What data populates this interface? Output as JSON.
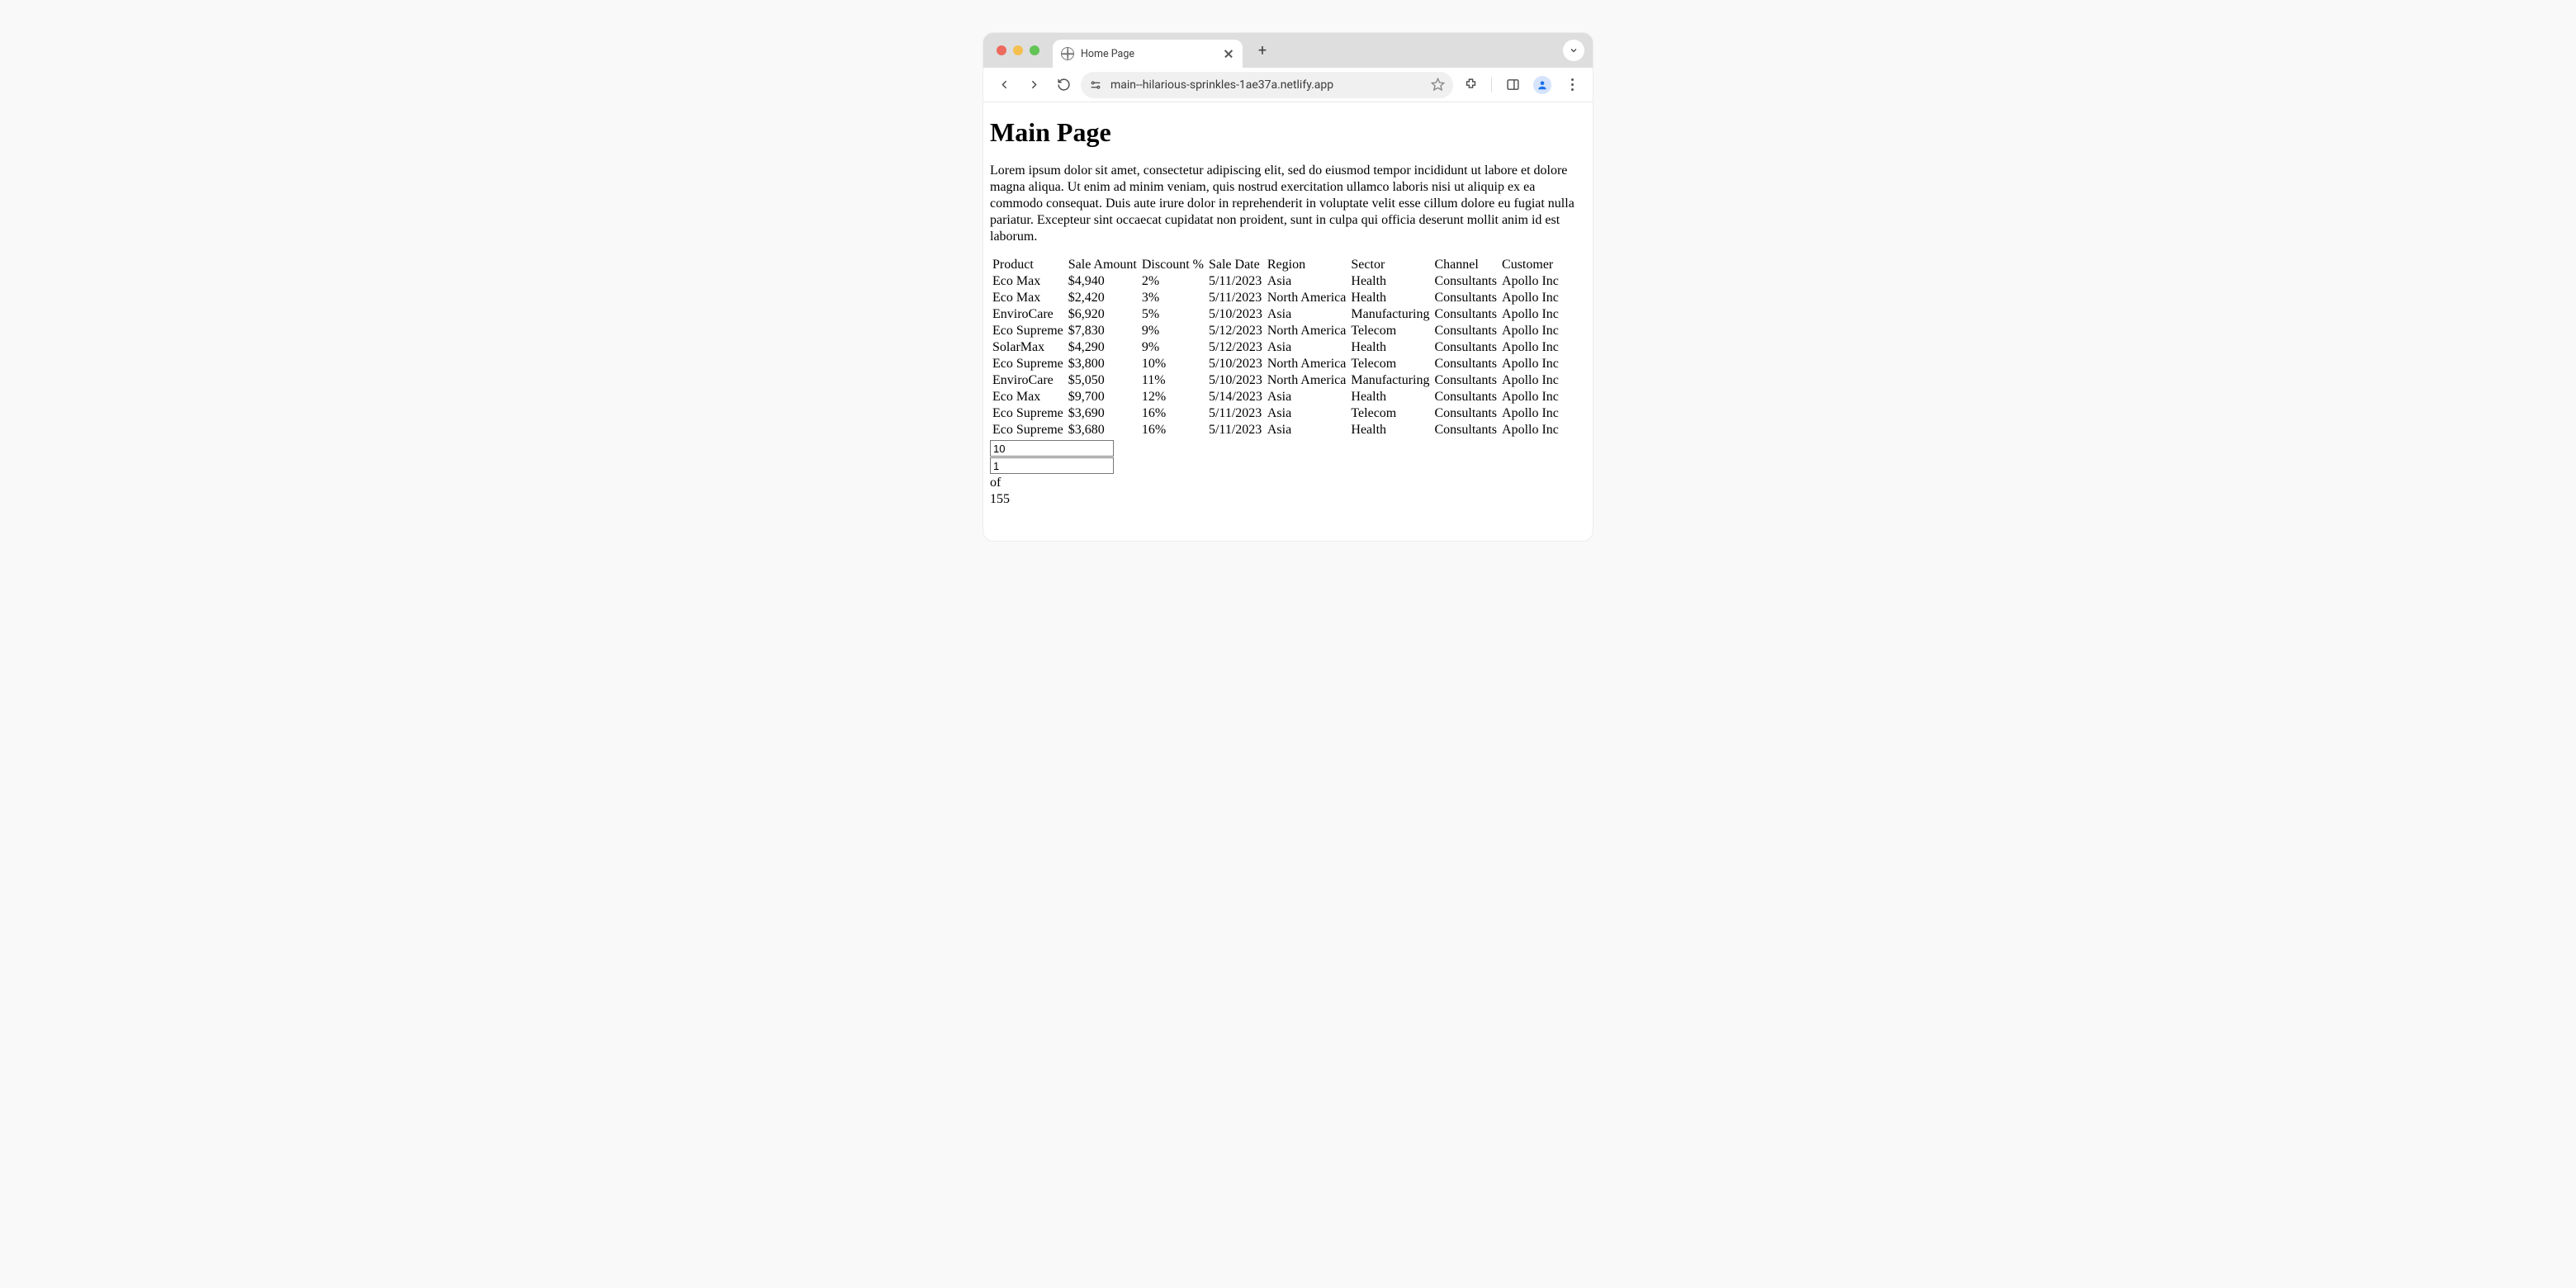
{
  "browser": {
    "tab_title": "Home Page",
    "url": "main--hilarious-sprinkles-1ae37a.netlify.app"
  },
  "page": {
    "title": "Main Page",
    "intro": "Lorem ipsum dolor sit amet, consectetur adipiscing elit, sed do eiusmod tempor incididunt ut labore et dolore magna aliqua. Ut enim ad minim veniam, quis nostrud exercitation ullamco laboris nisi ut aliquip ex ea commodo consequat. Duis aute irure dolor in reprehenderit in voluptate velit esse cillum dolore eu fugiat nulla pariatur. Excepteur sint occaecat cupidatat non proident, sunt in culpa qui officia deserunt mollit anim id est laborum."
  },
  "table": {
    "headers": {
      "product": "Product",
      "amount": "Sale Amount",
      "discount": "Discount %",
      "date": "Sale Date",
      "region": "Region",
      "sector": "Sector",
      "channel": "Channel",
      "customer": "Customer"
    },
    "rows": [
      {
        "product": "Eco Max",
        "amount": "$4,940",
        "discount": "2%",
        "date": "5/11/2023",
        "region": "Asia",
        "sector": "Health",
        "channel": "Consultants",
        "customer": "Apollo Inc"
      },
      {
        "product": "Eco Max",
        "amount": "$2,420",
        "discount": "3%",
        "date": "5/11/2023",
        "region": "North America",
        "sector": "Health",
        "channel": "Consultants",
        "customer": "Apollo Inc"
      },
      {
        "product": "EnviroCare",
        "amount": "$6,920",
        "discount": "5%",
        "date": "5/10/2023",
        "region": "Asia",
        "sector": "Manufacturing",
        "channel": "Consultants",
        "customer": "Apollo Inc"
      },
      {
        "product": "Eco Supreme",
        "amount": "$7,830",
        "discount": "9%",
        "date": "5/12/2023",
        "region": "North America",
        "sector": "Telecom",
        "channel": "Consultants",
        "customer": "Apollo Inc"
      },
      {
        "product": "SolarMax",
        "amount": "$4,290",
        "discount": "9%",
        "date": "5/12/2023",
        "region": "Asia",
        "sector": "Health",
        "channel": "Consultants",
        "customer": "Apollo Inc"
      },
      {
        "product": "Eco Supreme",
        "amount": "$3,800",
        "discount": "10%",
        "date": "5/10/2023",
        "region": "North America",
        "sector": "Telecom",
        "channel": "Consultants",
        "customer": "Apollo Inc"
      },
      {
        "product": "EnviroCare",
        "amount": "$5,050",
        "discount": "11%",
        "date": "5/10/2023",
        "region": "North America",
        "sector": "Manufacturing",
        "channel": "Consultants",
        "customer": "Apollo Inc"
      },
      {
        "product": "Eco Max",
        "amount": "$9,700",
        "discount": "12%",
        "date": "5/14/2023",
        "region": "Asia",
        "sector": "Health",
        "channel": "Consultants",
        "customer": "Apollo Inc"
      },
      {
        "product": "Eco Supreme",
        "amount": "$3,690",
        "discount": "16%",
        "date": "5/11/2023",
        "region": "Asia",
        "sector": "Telecom",
        "channel": "Consultants",
        "customer": "Apollo Inc"
      },
      {
        "product": "Eco Supreme",
        "amount": "$3,680",
        "discount": "16%",
        "date": "5/11/2023",
        "region": "Asia",
        "sector": "Health",
        "channel": "Consultants",
        "customer": "Apollo Inc"
      }
    ]
  },
  "pagination": {
    "page_size": "10",
    "current_page": "1",
    "of_label": "of",
    "total_pages": "155"
  }
}
